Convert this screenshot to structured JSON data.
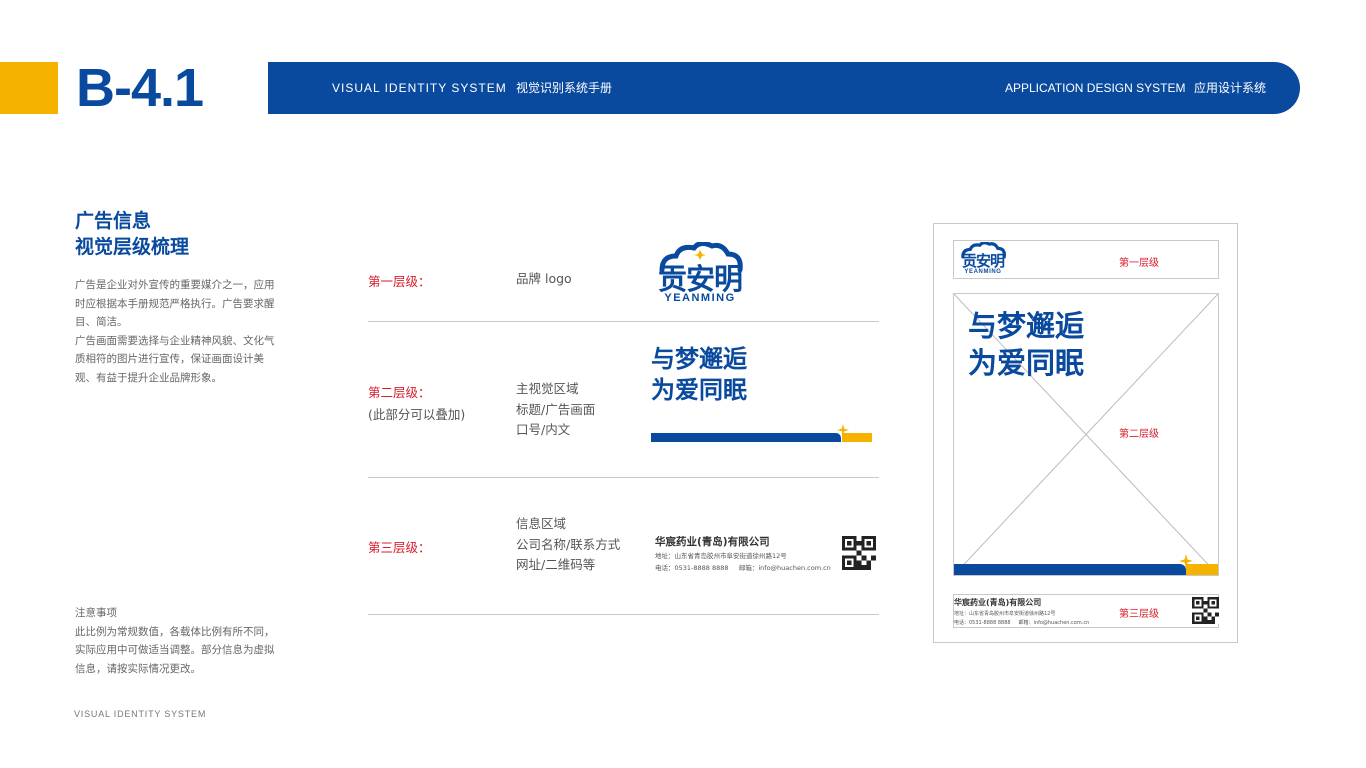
{
  "header": {
    "page_code": "B-4.1",
    "bar_left_en": "VISUAL IDENTITY SYSTEM",
    "bar_left_cn": "视觉识别系统手册",
    "bar_right_en": "APPLICATION DESIGN SYSTEM",
    "bar_right_cn": "应用设计系统"
  },
  "section": {
    "title_line1": "广告信息",
    "title_line2": "视觉层级梳理",
    "intro": [
      "广告是企业对外宣传的重要媒介之一，应用时应根据本手册规范严格执行。广告要求醒目、简洁。",
      "广告画面需要选择与企业精神风貌、文化气质相符的图片进行宣传，保证画面设计美观、有益于提升企业品牌形象。"
    ],
    "note_title": "注意事项",
    "note_body": "此比例为常规数值，各载体比例有所不同，实际应用中可做适当调整。部分信息为虚拟信息，请按实际情况更改。"
  },
  "levels": [
    {
      "label": "第一层级：",
      "sub": "",
      "desc": [
        "品牌 logo"
      ]
    },
    {
      "label": "第二层级：",
      "sub": "(此部分可以叠加)",
      "desc": [
        "主视觉区域",
        "标题/广告画面",
        "口号/内文"
      ]
    },
    {
      "label": "第三层级：",
      "sub": "",
      "desc": [
        "信息区域",
        "公司名称/联系方式",
        "网址/二维码等"
      ]
    }
  ],
  "brand": {
    "logo_cn": "贡安明",
    "logo_en": "YEANMING",
    "slogan_line1": "与梦邂逅",
    "slogan_line2": "为爱同眠"
  },
  "company": {
    "name": "华宸药业(青岛)有限公司",
    "address": "地址：山东省青岛胶州市阜安街道徐州路12号",
    "contact": "电话：0531-8888 8888     邮箱：info@huachen.com.cn"
  },
  "poster": {
    "level1": "第一层级",
    "level2": "第二层级",
    "level3": "第三层级"
  },
  "footer": {
    "text": "VISUAL IDENTITY SYSTEM"
  },
  "colors": {
    "brand_blue": "#0a4a9e",
    "accent_yellow": "#f5b300",
    "label_red": "#d91c2a"
  }
}
